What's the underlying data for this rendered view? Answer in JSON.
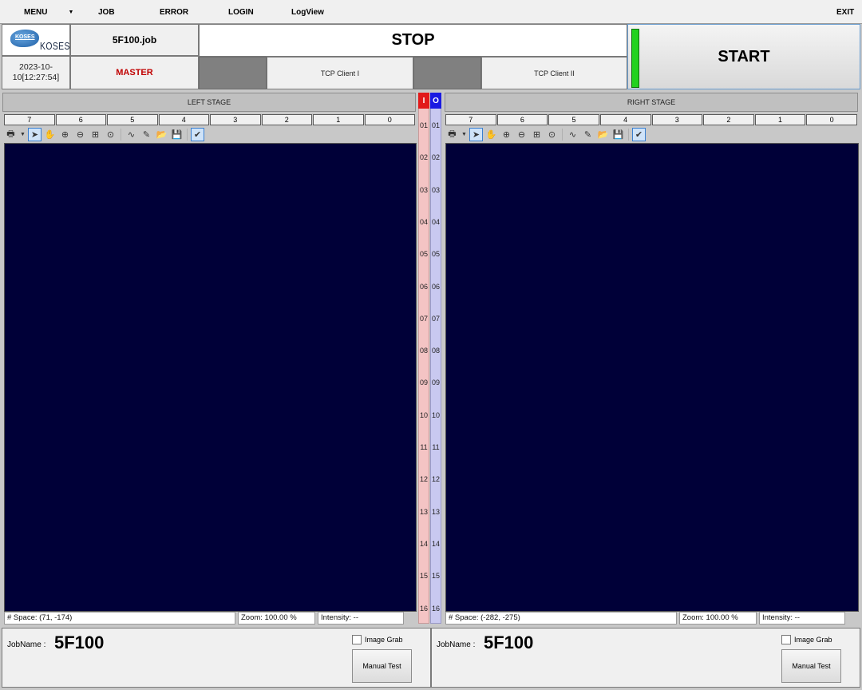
{
  "menu": {
    "items": [
      "MENU",
      "JOB",
      "ERROR",
      "LOGIN",
      "LogView"
    ],
    "exit": "EXIT"
  },
  "header": {
    "logo_small": "KOSES",
    "logo_text": "KOSES",
    "job_file": "5F100.job",
    "run_state": "STOP",
    "start_label": "START",
    "start_indicator_color": "#22d21f",
    "datetime": "2023-10-10[12:27:54]",
    "role": "MASTER",
    "tcp_client_1": "TCP Client I",
    "tcp_client_2": "TCP Client II"
  },
  "left_stage": {
    "title": "LEFT STAGE",
    "bits": [
      "7",
      "6",
      "5",
      "4",
      "3",
      "2",
      "1",
      "0"
    ],
    "status": {
      "space": "# Space: (71, -174)",
      "zoom": "Zoom: 100.00 %",
      "intensity": "Intensity: --"
    },
    "job_label": "JobName :",
    "job_name": "5F100",
    "image_grab": "Image Grab",
    "manual_test": "Manual Test"
  },
  "right_stage": {
    "title": "RIGHT STAGE",
    "bits": [
      "7",
      "6",
      "5",
      "4",
      "3",
      "2",
      "1",
      "0"
    ],
    "status": {
      "space": "# Space: (-282, -275)",
      "zoom": "Zoom: 100.00 %",
      "intensity": "Intensity: --"
    },
    "job_label": "JobName :",
    "job_name": "5F100",
    "image_grab": "Image Grab",
    "manual_test": "Manual Test"
  },
  "io": {
    "in_label": "I",
    "out_label": "O",
    "channels": [
      "01",
      "02",
      "03",
      "04",
      "05",
      "06",
      "07",
      "08",
      "09",
      "10",
      "11",
      "12",
      "13",
      "14",
      "15",
      "16"
    ]
  },
  "toolbar_icons": [
    "print-icon",
    "dropdown-arrow-icon",
    "pointer-icon",
    "pan-icon",
    "zoom-in-icon",
    "zoom-out-icon",
    "zoom-fit-icon",
    "zoom-reset-icon",
    "line-profile-icon",
    "color-picker-icon",
    "open-folder-icon",
    "save-icon",
    "check-overlay-icon"
  ],
  "viewer_background": "#000038"
}
